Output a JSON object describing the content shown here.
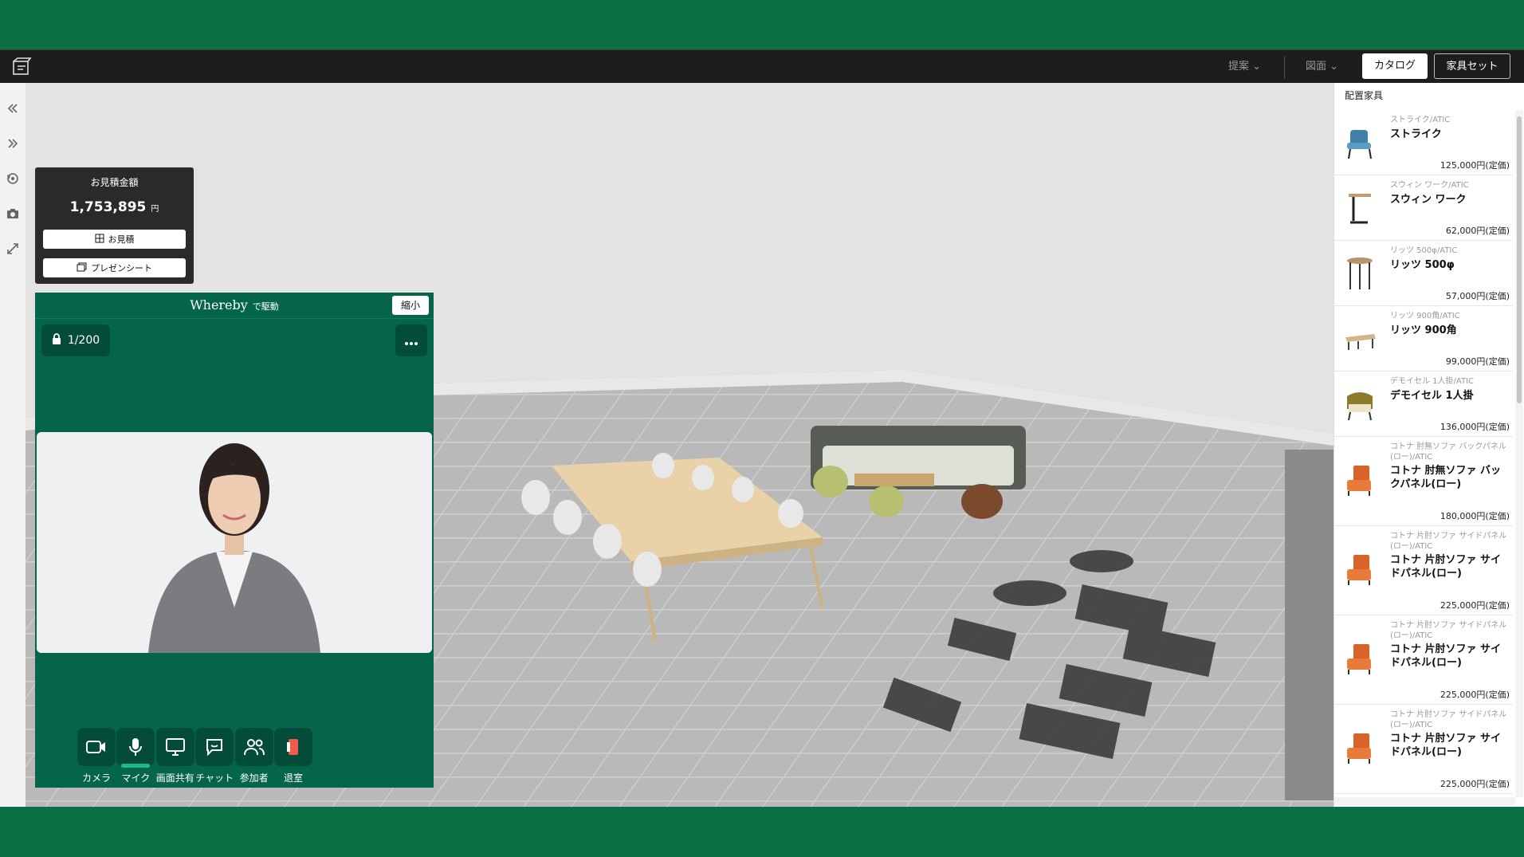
{
  "toolbar": {
    "proposal": "提案",
    "drawing": "図面",
    "catalog": "カタログ",
    "furniture_set": "家具セット"
  },
  "left_tools": [
    "collapse-left-icon",
    "expand-right-icon",
    "rotate-view-icon",
    "camera-icon",
    "fullscreen-icon"
  ],
  "estimate": {
    "title": "お見積金額",
    "amount": "1,753,895",
    "currency": "円",
    "quote_button": "お見積",
    "present_button": "プレゼンシート"
  },
  "whereby": {
    "brand": "Whereby",
    "tagline": "で駆動",
    "shrink": "縮小",
    "room_count": "1/200",
    "controls": [
      {
        "label": "カメラ",
        "icon": "camera-icon"
      },
      {
        "label": "マイク",
        "icon": "microphone-icon"
      },
      {
        "label": "画面共有",
        "icon": "screen-share-icon"
      },
      {
        "label": "チャット",
        "icon": "chat-icon"
      },
      {
        "label": "参加者",
        "icon": "participants-icon"
      },
      {
        "label": "退室",
        "icon": "leave-icon"
      }
    ]
  },
  "panel": {
    "title": "配置家具",
    "items": [
      {
        "brand": "ストライク/ATIC",
        "name": "ストライク",
        "price": "125,000円(定価)",
        "icon": "armchair-blue-icon"
      },
      {
        "brand": "スウィン ワーク/ATIC",
        "name": "スウィン ワーク",
        "price": "62,000円(定価)",
        "icon": "side-table-icon"
      },
      {
        "brand": "リッツ 500φ/ATIC",
        "name": "リッツ 500φ",
        "price": "57,000円(定価)",
        "icon": "high-table-icon"
      },
      {
        "brand": "リッツ 900角/ATIC",
        "name": "リッツ 900角",
        "price": "99,000円(定価)",
        "icon": "low-table-icon"
      },
      {
        "brand": "デモイセル 1人掛/ATIC",
        "name": "デモイセル 1人掛",
        "price": "136,000円(定価)",
        "icon": "lounge-chair-icon"
      },
      {
        "brand": "コトナ 肘無ソファ バックパネル(ロー)/ATIC",
        "name": "コトナ 肘無ソファ バックパネル(ロー)",
        "price": "180,000円(定価)",
        "icon": "sofa-orange-icon"
      },
      {
        "brand": "コトナ 片肘ソファ サイドパネル(ロー)/ATIC",
        "name": "コトナ 片肘ソファ サイドパネル(ロー)",
        "price": "225,000円(定価)",
        "icon": "sofa-orange-icon"
      },
      {
        "brand": "コトナ 片肘ソファ サイドパネル(ロー)/ATIC",
        "name": "コトナ 片肘ソファ サイドパネル(ロー)",
        "price": "225,000円(定価)",
        "icon": "sofa-orange-icon"
      },
      {
        "brand": "コトナ 片肘ソファ サイドパネル(ロー)/ATIC",
        "name": "コトナ 片肘ソファ サイドパネル(ロー)",
        "price": "225,000円(定価)",
        "icon": "sofa-orange-icon"
      }
    ]
  },
  "colors": {
    "brand_green": "#0b7045",
    "whereby_green": "#04654a",
    "toolbar": "#1d1d1d"
  }
}
